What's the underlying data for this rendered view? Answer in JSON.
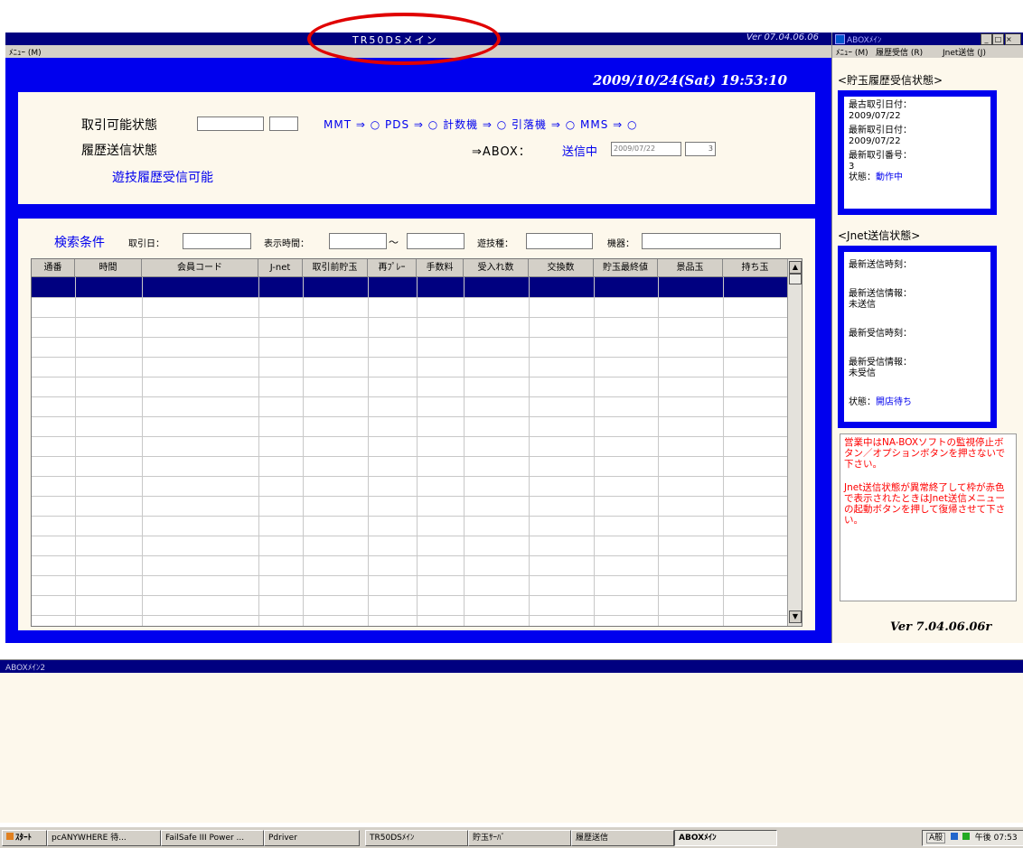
{
  "main_window": {
    "title": "TR50DSメイン",
    "version_label": "Ver 07.04.06.06",
    "menu_label": "ﾒﾆｭｰ (M)",
    "datetime": "2009/10/24(Sat) 19:53:10"
  },
  "status": {
    "trade_state_label": "取引可能状態",
    "history_state_label": "履歴送信状態",
    "device_chain": "MMT ⇒ ○ PDS ⇒ ○ 計数機 ⇒ ○ 引落機 ⇒ ○ MMS ⇒ ○",
    "abox_prefix": "⇒ABOX：",
    "abox_status": "送信中",
    "abox_date": "2009/07/22",
    "abox_count": "3",
    "remote_ready": "遊技履歴受信可能"
  },
  "search": {
    "title": "検索条件",
    "trade_date_label": "取引日：",
    "display_time_label": "表示時間：",
    "tilde": "～",
    "game_type_label": "遊技種：",
    "machine_label": "機器："
  },
  "table": {
    "columns": [
      "通番",
      "時間",
      "会員コード",
      "J-net",
      "取引前貯玉",
      "再ﾌﾟﾚｰ",
      "手数料",
      "受入れ数",
      "交換数",
      "貯玉最終値",
      "景品玉",
      "持ち玉"
    ]
  },
  "abox_window": {
    "title": "ABOXﾒｲﾝ",
    "menu": [
      "ﾒﾆｭｰ (M)",
      "履歴受信 (R)",
      "Jnet送信 (J)"
    ],
    "history_section": "<貯玉履歴受信状態>",
    "history_info": {
      "oldest_label": "最古取引日付：",
      "oldest_value": "2009/07/22",
      "newest_label": "最新取引日付：",
      "newest_value": "2009/07/22",
      "number_label": "最新取引番号：",
      "number_value": "3",
      "state_label": "状態：",
      "state_value": "動作中"
    },
    "jnet_section": "<Jnet送信状態>",
    "jnet_info": {
      "send_time_label": "最新送信時刻：",
      "send_info_label": "最新送信情報：",
      "send_info_value": "未送信",
      "recv_time_label": "最新受信時刻：",
      "recv_info_label": "最新受信情報：",
      "recv_info_value": "未受信",
      "state_label": "状態：",
      "state_value": "開店待ち"
    },
    "warning_1": "営業中はNA-BOXソフトの監視停止ボタン／オプションボタンを押さないで下さい。",
    "warning_2": "Jnet送信状態が異常終了して枠が赤色で表示されたときはJnet送信メニューの起動ボタンを押して復帰させて下さい。",
    "version": "Ver 7.04.06.06r"
  },
  "sub_window": {
    "title": "ABOXﾒｲﾝ2"
  },
  "taskbar": {
    "start": "ｽﾀｰﾄ",
    "tasks": [
      "pcANYWHERE 待...",
      "FailSafe III Power ...",
      "Pdriver",
      "TR50DSﾒｲﾝ",
      "貯玉ｻｰﾊﾞ",
      "履歴送信",
      "ABOXﾒｲﾝ"
    ],
    "tray_ime": "A般",
    "clock": "午後 07:53"
  },
  "colors": {
    "window_blue": "#0000ee",
    "title_navy": "#000080",
    "panel_cream": "#fdf8ec",
    "annotation_red": "#e00000"
  }
}
